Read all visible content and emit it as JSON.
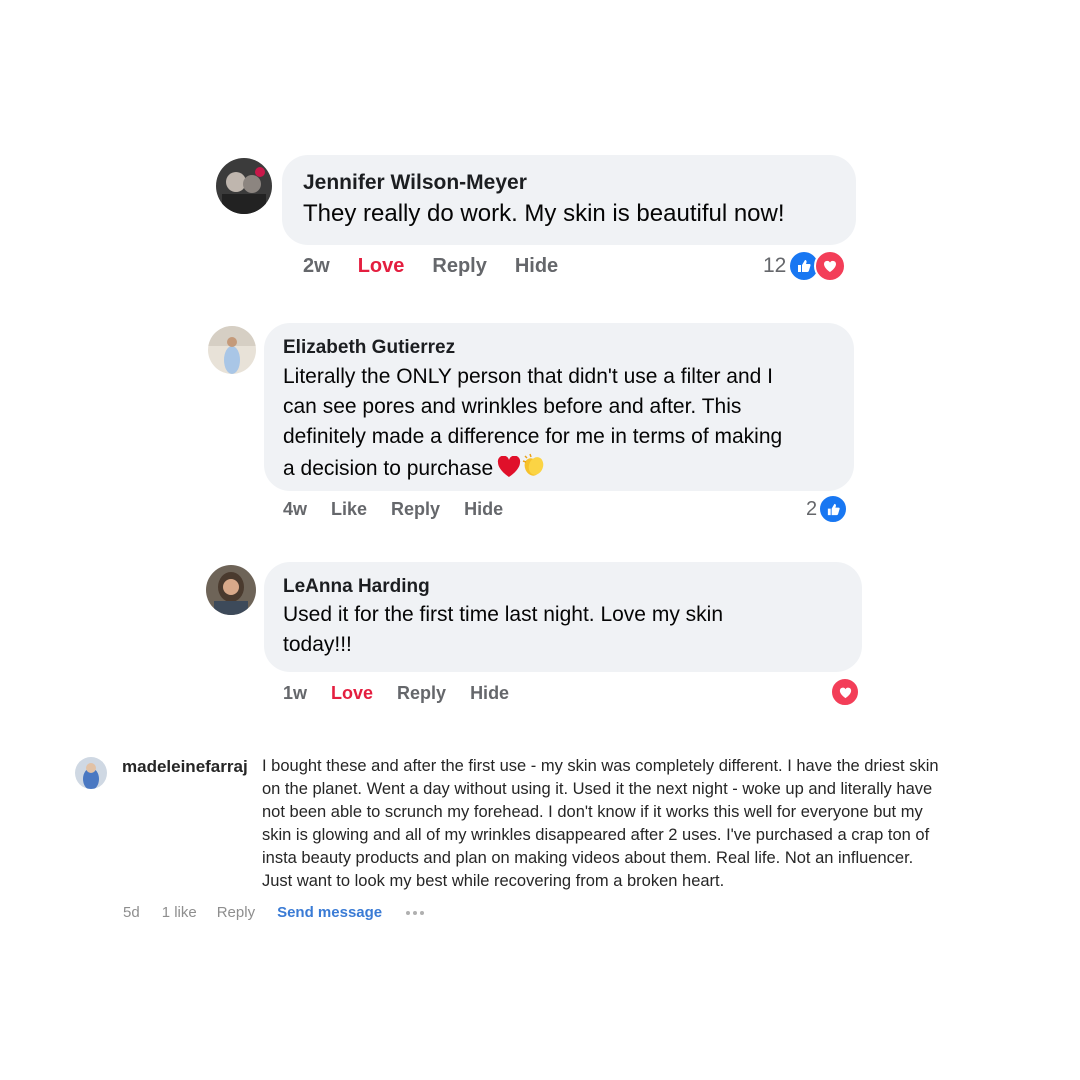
{
  "colors": {
    "bubble": "#f0f2f5",
    "love_text": "#e41e3f",
    "like_blue": "#1877f2",
    "love_red": "#f33e58",
    "muted": "#65676b",
    "ig_link": "#3a7bd5"
  },
  "comments": [
    {
      "author": "Jennifer Wilson-Meyer",
      "lines": [
        "They really do work. My skin is beautiful now!"
      ],
      "time": "2w",
      "react_label": "Love",
      "reply": "Reply",
      "hide": "Hide",
      "reaction_count": "12",
      "reactions": [
        "like-icon",
        "love-icon"
      ]
    },
    {
      "author": "Elizabeth Gutierrez",
      "lines": [
        "Literally the ONLY person that didn't use a filter and I",
        "can see pores and wrinkles before and after. This",
        "definitely made a difference for me in terms of making",
        "a decision to purchase"
      ],
      "emojis": [
        "red-heart-emoji",
        "clapping-hands-emoji"
      ],
      "time": "4w",
      "react_label": "Like",
      "reply": "Reply",
      "hide": "Hide",
      "reaction_count": "2",
      "reactions": [
        "like-icon"
      ]
    },
    {
      "author": "LeAnna Harding",
      "lines": [
        "Used it for the first time last night. Love my skin",
        "today!!!"
      ],
      "time": "1w",
      "react_label": "Love",
      "reply": "Reply",
      "hide": "Hide",
      "reaction_count": "",
      "reactions": [
        "love-icon"
      ]
    }
  ],
  "ig_comment": {
    "username": "madeleinefarraj",
    "lines": [
      "I bought these and after the first use - my skin was completely different. I have the driest skin",
      "on the planet. Went a day without using it. Used it the next night - woke up and literally have",
      "not been able to scrunch my forehead. I don't know if it works this well for everyone but my",
      "skin is glowing and all of my wrinkles disappeared after 2 uses. I've purchased a crap ton of",
      "insta beauty products and plan on making videos about them. Real life. Not an influencer.",
      "Just want to look my best while recovering from a broken heart."
    ],
    "time": "5d",
    "likes": "1 like",
    "reply": "Reply",
    "send": "Send message",
    "more_icon": "more-options-icon"
  }
}
